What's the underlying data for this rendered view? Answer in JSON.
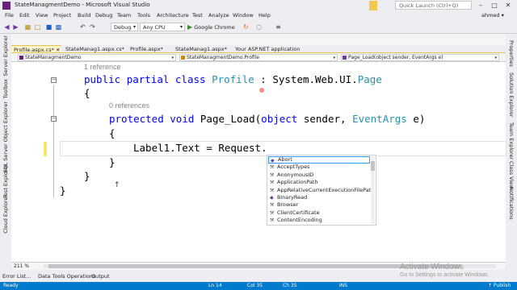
{
  "window": {
    "title": "StateManagmentDemo - Microsoft Visual Studio",
    "quick_launch_placeholder": "Quick Launch (Ctrl+Q)",
    "badge_count": "1",
    "minimize": "–",
    "maximize": "□",
    "close": "✕"
  },
  "menu": [
    "File",
    "Edit",
    "View",
    "Project",
    "Build",
    "Debug",
    "Team",
    "Tools",
    "Architecture",
    "Test",
    "Analyze",
    "Window",
    "Help"
  ],
  "user": "ahmed ▾",
  "toolbar": {
    "config": "Debug",
    "platform": "Any CPU",
    "run_target": "Google Chrome"
  },
  "left_side_tabs": [
    "Server Explorer",
    "Toolbox",
    "SQL Server Object Explorer",
    "Test Explorer",
    "Cloud Explorer"
  ],
  "right_side_tabs": [
    "Properties",
    "Solution Explorer",
    "Team Explorer",
    "Class View",
    "Notifications"
  ],
  "doc_tabs": [
    "Profile.aspx.cs*",
    "StateManag1.aspx.cs*",
    "Profile.aspx*",
    "StateManag1.aspx*",
    "Your ASP.NET application"
  ],
  "nav": {
    "project": "StateManagmentDemo",
    "class": "StateManagmentDemo.Profile",
    "member": "Page_Load(object sender, EventArgs e)"
  },
  "code": {
    "ref1": "1 reference",
    "class_decl": {
      "kw1": "public",
      "kw2": "partial",
      "kw3": "class",
      "name": "Profile",
      "colon": " : ",
      "base": "System.Web.UI.",
      "base_type": "Page"
    },
    "brace_open1": "{",
    "ref2": "0 references",
    "method_decl": {
      "kw1": "protected",
      "kw2": "void",
      "name": " Page_Load(",
      "kw3": "object",
      "p1": " sender, ",
      "type": "EventArgs",
      "p2": " e)"
    },
    "brace_open2": "{",
    "statement": "Label1.Text = Request.",
    "brace_close2": "}",
    "brace_close1": "}",
    "brace_close0": "}"
  },
  "intellisense": [
    {
      "label": "Abort",
      "kind": "method"
    },
    {
      "label": "AcceptTypes",
      "kind": "property"
    },
    {
      "label": "AnonymousID",
      "kind": "property"
    },
    {
      "label": "ApplicationPath",
      "kind": "property"
    },
    {
      "label": "AppRelativeCurrentExecutionFilePath",
      "kind": "property"
    },
    {
      "label": "BinaryRead",
      "kind": "method"
    },
    {
      "label": "Browser",
      "kind": "property"
    },
    {
      "label": "ClientCertificate",
      "kind": "property"
    },
    {
      "label": "ContentEncoding",
      "kind": "property"
    }
  ],
  "zoom": "211 %",
  "tool_tabs": [
    "Error List...",
    "Data Tools Operations",
    "Output"
  ],
  "status": {
    "state": "Ready",
    "ln": "Ln 14",
    "col": "Col 35",
    "ch": "Ch 35",
    "ins": "INS",
    "publish": "↑ Publish"
  },
  "watermark": {
    "line1": "Activate Windows",
    "line2": "Go to Settings to activate Windows."
  },
  "colors": {
    "accent": "#007acc",
    "keyword": "#0000ff",
    "type": "#2b91af",
    "active_tab": "#fff5cc"
  }
}
